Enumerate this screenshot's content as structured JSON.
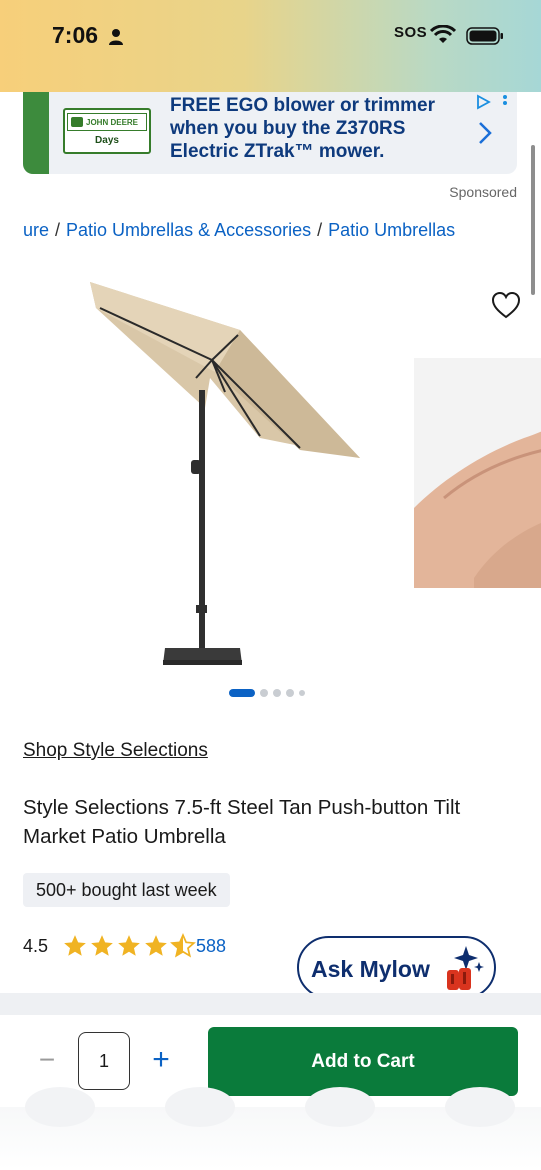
{
  "status_bar": {
    "time": "7:06",
    "carrier": "SOS"
  },
  "ad": {
    "brand_top": "JOHN DEERE",
    "brand_bottom": "Days",
    "line1": "FREE EGO blower or trimmer",
    "line2": "when you buy the Z370RS",
    "line3": "Electric ZTrak™ mower.",
    "sponsored_label": "Sponsored"
  },
  "breadcrumb": {
    "items": [
      "ure",
      "Patio Umbrellas & Accessories",
      "Patio Umbrellas"
    ],
    "separator": "/"
  },
  "gallery": {
    "image_count": 5,
    "active_index": 0
  },
  "product": {
    "brand_link": "Shop Style Selections",
    "title": "Style Selections 7.5-ft Steel Tan Push-button Tilt Market Patio Umbrella",
    "bought_badge": "500+ bought last week",
    "rating": "4.5",
    "rating_value": 4.5,
    "review_count": "588"
  },
  "assistant": {
    "label": "Ask Mylow"
  },
  "cart": {
    "minus": "−",
    "quantity": "1",
    "plus": "+",
    "add_to_cart": "Add to Cart"
  },
  "colors": {
    "accent_blue": "#0b62c4",
    "cart_green": "#0a7b3b",
    "navy": "#0e2e6e",
    "star": "#f0b323"
  }
}
